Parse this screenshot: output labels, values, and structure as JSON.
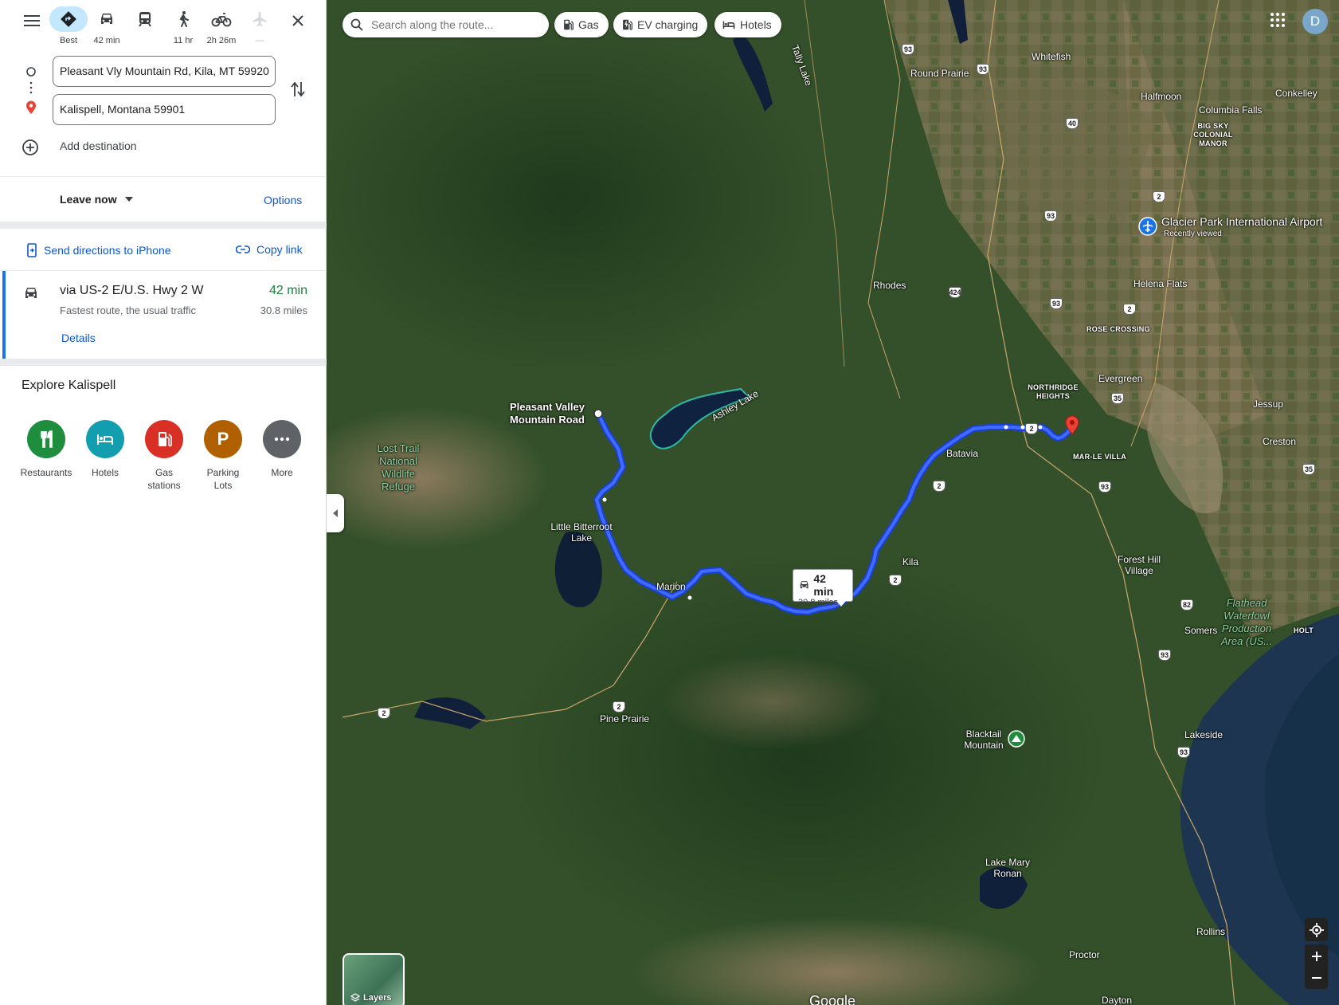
{
  "modes": [
    {
      "name": "best",
      "label": "Best",
      "icon": "route-diamond-icon"
    },
    {
      "name": "driving",
      "label": "42 min",
      "icon": "car-icon"
    },
    {
      "name": "transit",
      "label": "",
      "icon": "train-icon"
    },
    {
      "name": "walking",
      "label": "11 hr",
      "icon": "walking-icon"
    },
    {
      "name": "cycling",
      "label": "2h 26m",
      "icon": "bicycle-icon"
    },
    {
      "name": "flights",
      "label": "—",
      "icon": "airplane-icon"
    }
  ],
  "inputs": {
    "origin": "Pleasant Vly Mountain Rd, Kila, MT 59920",
    "destination": "Kalispell, Montana 59901",
    "add_destination": "Add destination"
  },
  "timing": {
    "leave": "Leave now",
    "options": "Options"
  },
  "actions": {
    "send": "Send directions to iPhone",
    "copy": "Copy link"
  },
  "route": {
    "title": "via US-2 E/U.S. Hwy 2 W",
    "subtitle": "Fastest route, the usual traffic",
    "time": "42 min",
    "distance": "30.8 miles",
    "details": "Details"
  },
  "explore": {
    "title": "Explore Kalispell",
    "categories": [
      {
        "label": "Restaurants",
        "color": "#1e8e3e"
      },
      {
        "label": "Hotels",
        "color": "#129eaf"
      },
      {
        "label": "Gas stations",
        "color": "#d93025"
      },
      {
        "label": "Parking Lots",
        "color": "#b06000"
      },
      {
        "label": "More",
        "color": "#5f6368"
      }
    ]
  },
  "map": {
    "search_placeholder": "Search along the route...",
    "chips": [
      "Gas",
      "EV charging",
      "Hotels"
    ],
    "avatar": "D",
    "callout": {
      "time": "42 min",
      "distance": "30.8 miles"
    },
    "layers": "Layers",
    "attribution": "Google",
    "labels": {
      "tally": "Tally Lake",
      "whitefish": "Whitefish",
      "round": "Round Prairie",
      "halfmoon": "Halfmoon",
      "conkelley": "Conkelley",
      "columbia": "Columbia Falls",
      "bigsky": "BIG SKY COLONIAL MANOR",
      "airport": "Glacier Park International Airport",
      "recent": "Recently viewed",
      "rhodes": "Rhodes",
      "helena": "Helena Flats",
      "rose": "ROSE CROSSING",
      "evergreen": "Evergreen",
      "northridge": "NORTHRIDGE HEIGHTS",
      "jessup": "Jessup",
      "creston": "Creston",
      "marle": "MAR-LE VILLA",
      "batavia": "Batavia",
      "pvm": "Pleasant Valley Mountain Road",
      "ashley": "Ashley Lake",
      "losttrail": "Lost Trail National Wildlife Refuge",
      "lbl": "Little Bitterroot Lake",
      "marion": "Marion",
      "kila": "Kila",
      "forest": "Forest Hill Village",
      "somers": "Somers",
      "flathead": "Flathead Waterfowl Production Area (US...",
      "holt": "HOLT",
      "pine": "Pine Prairie",
      "blacktail": "Blacktail Mountain",
      "lakeside": "Lakeside",
      "lakemary": "Lake Mary Ronan",
      "rollins": "Rollins",
      "proctor": "Proctor",
      "dayton": "Dayton"
    },
    "shields": [
      "93",
      "93",
      "40",
      "2",
      "93",
      "424",
      "93",
      "2",
      "35",
      "2",
      "93",
      "35",
      "2",
      "2",
      "2",
      "2",
      "93",
      "82",
      "93"
    ]
  }
}
